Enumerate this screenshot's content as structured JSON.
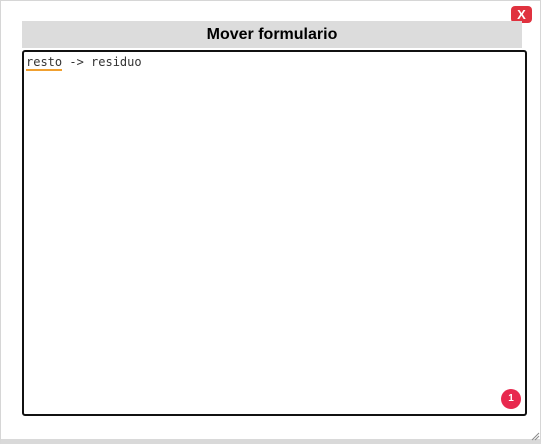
{
  "dialog": {
    "title": "Mover formulario",
    "close_label": "X"
  },
  "editor": {
    "line_misspelled_word": "resto",
    "line_rest": " -> residuo",
    "error_count": "1"
  },
  "colors": {
    "close_button": "#e0323f",
    "title_bar": "#dcdcdc",
    "error_badge": "#e8284e",
    "squiggle": "#f0a030"
  },
  "icons": {
    "resize": "resize-grip-icon"
  }
}
